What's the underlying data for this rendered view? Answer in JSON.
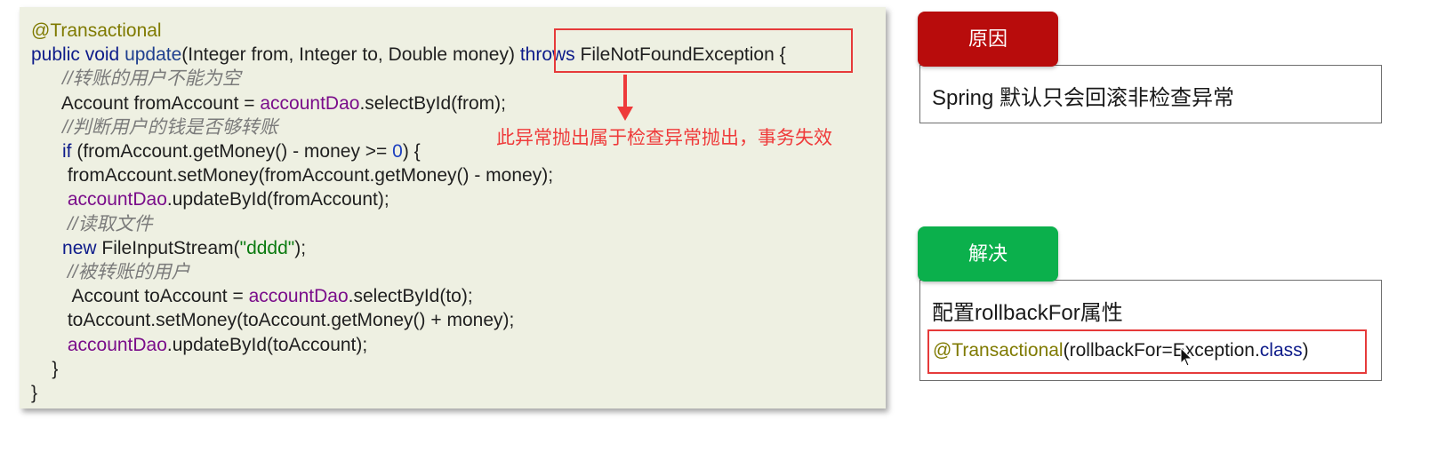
{
  "code": {
    "lines": [
      [
        {
          "t": "@Transactional",
          "c": "ann"
        }
      ],
      [
        {
          "t": "public void ",
          "c": "kw"
        },
        {
          "t": "update",
          "c": "fn"
        },
        {
          "t": "(Integer from, Integer to, Double money) ",
          "c": ""
        },
        {
          "t": "throws ",
          "c": "kw"
        },
        {
          "t": "FileNotFoundException {",
          "c": ""
        }
      ],
      [
        {
          "t": "      //转账的用户不能为空",
          "c": "cmt"
        }
      ],
      [
        {
          "t": "      Account fromAccount = ",
          "c": ""
        },
        {
          "t": "accountDao",
          "c": "fld"
        },
        {
          "t": ".selectById(from);",
          "c": ""
        }
      ],
      [
        {
          "t": "      //判断用户的钱是否够转账",
          "c": "cmt"
        }
      ],
      [
        {
          "t": "      ",
          "c": ""
        },
        {
          "t": "if",
          "c": "kw"
        },
        {
          "t": " (fromAccount.getMoney() - money >= ",
          "c": ""
        },
        {
          "t": "0",
          "c": "num"
        },
        {
          "t": ") {",
          "c": ""
        }
      ],
      [
        {
          "t": "       fromAccount.setMoney(fromAccount.getMoney() - money);",
          "c": ""
        }
      ],
      [
        {
          "t": "       ",
          "c": ""
        },
        {
          "t": "accountDao",
          "c": "fld"
        },
        {
          "t": ".updateById(fromAccount);",
          "c": ""
        }
      ],
      [
        {
          "t": "       //读取文件",
          "c": "cmt"
        }
      ],
      [
        {
          "t": "      ",
          "c": ""
        },
        {
          "t": "new",
          "c": "kw"
        },
        {
          "t": " FileInputStream(",
          "c": ""
        },
        {
          "t": "\"dddd\"",
          "c": "str"
        },
        {
          "t": ");",
          "c": ""
        }
      ],
      [
        {
          "t": "       //被转账的用户",
          "c": "cmt"
        }
      ],
      [
        {
          "t": "        Account toAccount = ",
          "c": ""
        },
        {
          "t": "accountDao",
          "c": "fld"
        },
        {
          "t": ".selectById(to);",
          "c": ""
        }
      ],
      [
        {
          "t": "       toAccount.setMoney(toAccount.getMoney() + money);",
          "c": ""
        }
      ],
      [
        {
          "t": "       ",
          "c": ""
        },
        {
          "t": "accountDao",
          "c": "fld"
        },
        {
          "t": ".updateById(toAccount);",
          "c": ""
        }
      ],
      [
        {
          "t": "    }",
          "c": ""
        }
      ],
      [
        {
          "t": "}",
          "c": ""
        }
      ]
    ]
  },
  "annotation": {
    "text": "此异常抛出属于检查异常抛出，事务失效"
  },
  "reason": {
    "tab_label": "原因",
    "tab_color": "#b80c0c",
    "text": "Spring 默认只会回滚非检查异常"
  },
  "solution": {
    "tab_label": "解决",
    "tab_color": "#0bb04c",
    "text": "配置rollbackFor属性",
    "code_ann": "@Transactional",
    "code_rest": "(rollbackFor=Exception.",
    "code_kw": "class",
    "code_end": ")"
  },
  "colors": {
    "highlight_red": "#e63a3a",
    "code_bg": "#eef0e2"
  }
}
